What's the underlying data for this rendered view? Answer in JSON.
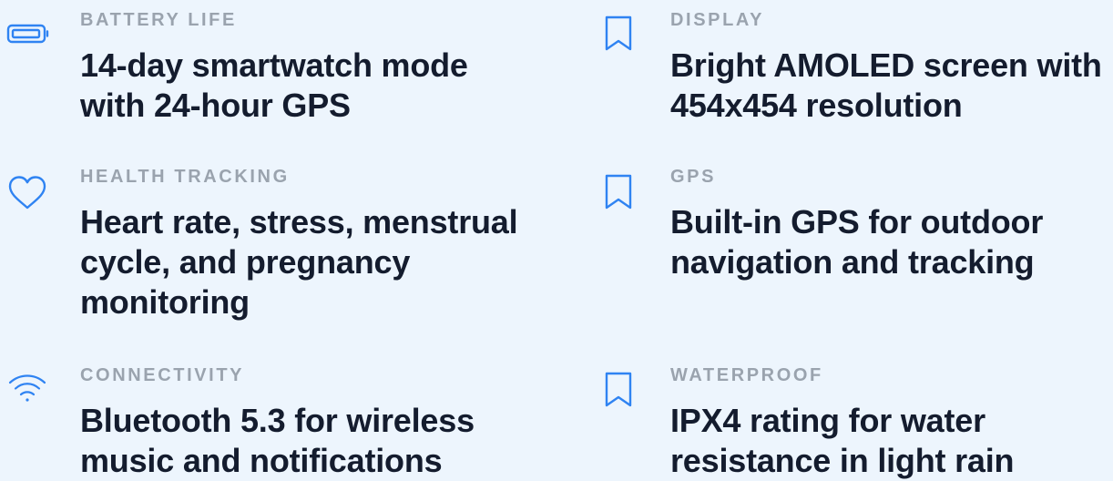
{
  "colors": {
    "background": "#edf5fd",
    "accent": "#2f83f2",
    "label": "#9aa3ae",
    "heading": "#141c2e"
  },
  "features": [
    {
      "icon": "battery-icon",
      "label": "BATTERY LIFE",
      "description": "14-day smartwatch mode with 24-hour GPS"
    },
    {
      "icon": "bookmark-icon",
      "label": "DISPLAY",
      "description": "Bright AMOLED screen with 454x454 resolution"
    },
    {
      "icon": "heart-icon",
      "label": "HEALTH TRACKING",
      "description": "Heart rate, stress, menstrual cycle, and pregnancy monitoring"
    },
    {
      "icon": "bookmark-icon",
      "label": "GPS",
      "description": "Built-in GPS for outdoor navigation and tracking"
    },
    {
      "icon": "wifi-icon",
      "label": "CONNECTIVITY",
      "description": "Bluetooth 5.3 for wireless music and notifications"
    },
    {
      "icon": "bookmark-icon",
      "label": "WATERPROOF",
      "description": "IPX4 rating for water resistance in light rain"
    }
  ]
}
